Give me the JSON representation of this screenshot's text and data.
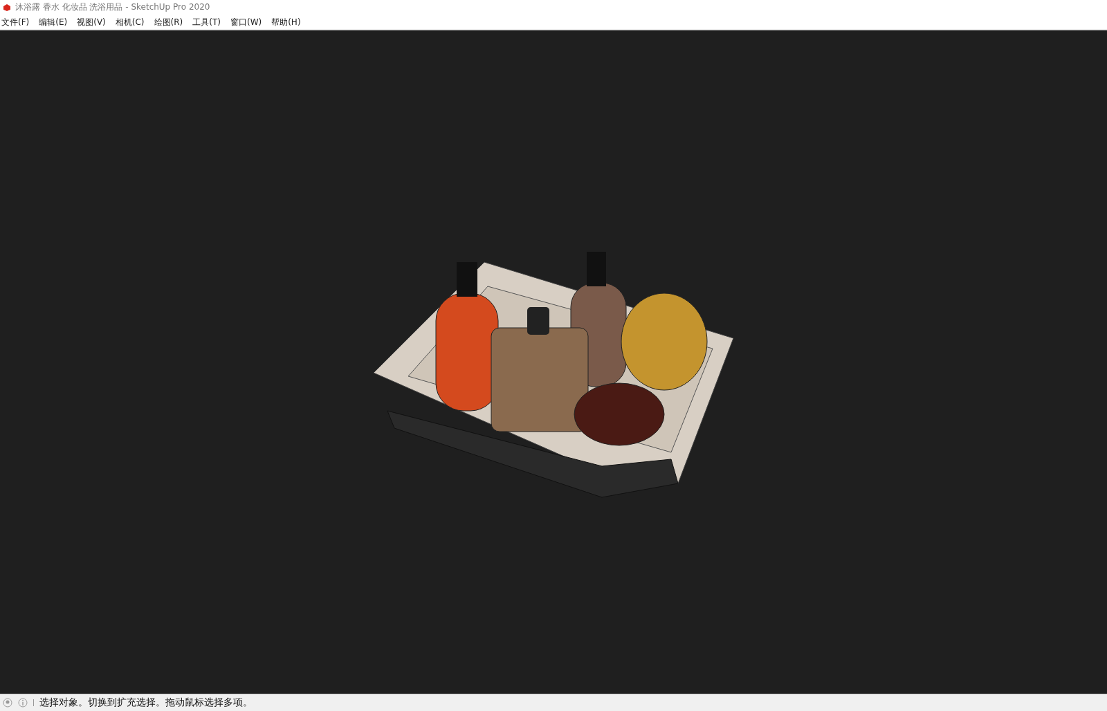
{
  "window": {
    "title": "沐浴露 香水 化妆品 洗浴用品 - SketchUp Pro 2020"
  },
  "menu": [
    "文件(F)",
    "编辑(E)",
    "视图(V)",
    "相机(C)",
    "绘图(R)",
    "工具(T)",
    "窗口(W)",
    "帮助(H)"
  ],
  "status_bar": {
    "message": "选择对象。切换到扩充选择。拖动鼠标选择多项。"
  }
}
